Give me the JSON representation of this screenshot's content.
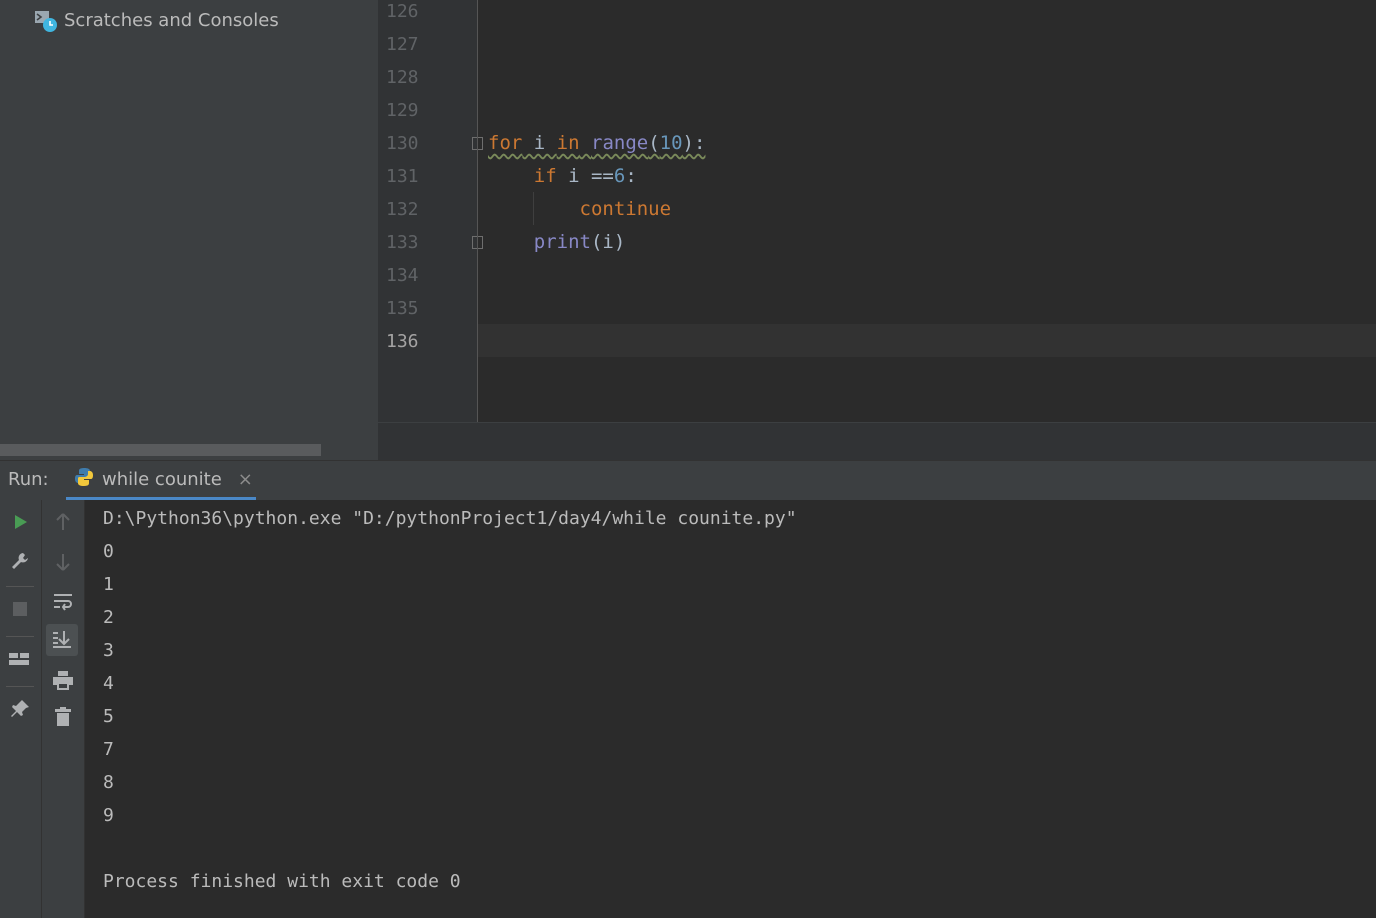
{
  "project": {
    "items": [
      {
        "label": "Scratches and Consoles",
        "icon": "scratches-icon"
      }
    ]
  },
  "editor": {
    "line_numbers": [
      "126",
      "127",
      "128",
      "129",
      "130",
      "131",
      "132",
      "133",
      "134",
      "135",
      "136"
    ],
    "current_line": "136",
    "code": [
      {
        "line": "130",
        "tokens": [
          {
            "t": "for",
            "c": "kw"
          },
          {
            "t": " i ",
            "c": "plain"
          },
          {
            "t": "in",
            "c": "kw"
          },
          {
            "t": " ",
            "c": "plain"
          },
          {
            "t": "range",
            "c": "bi"
          },
          {
            "t": "(",
            "c": "plain"
          },
          {
            "t": "10",
            "c": "num"
          },
          {
            "t": "):",
            "c": "plain"
          }
        ]
      },
      {
        "line": "131",
        "tokens": [
          {
            "t": "    ",
            "c": "plain"
          },
          {
            "t": "if",
            "c": "kw"
          },
          {
            "t": " i ==",
            "c": "plain"
          },
          {
            "t": "6",
            "c": "num"
          },
          {
            "t": ":",
            "c": "plain"
          }
        ]
      },
      {
        "line": "132",
        "tokens": [
          {
            "t": "        ",
            "c": "plain"
          },
          {
            "t": "continue",
            "c": "kw"
          }
        ]
      },
      {
        "line": "133",
        "tokens": [
          {
            "t": "    ",
            "c": "plain"
          },
          {
            "t": "print",
            "c": "bi"
          },
          {
            "t": "(i)",
            "c": "plain"
          }
        ]
      }
    ]
  },
  "run": {
    "label": "Run:",
    "tab_title": "while counite",
    "tab_close": "×",
    "output": [
      "D:\\Python36\\python.exe \"D:/pythonProject1/day4/while counite.py\"",
      "0",
      "1",
      "2",
      "3",
      "4",
      "5",
      "7",
      "8",
      "9",
      "",
      "Process finished with exit code 0"
    ]
  },
  "icons": {
    "left_toolbar": [
      "run-icon",
      "wrench-icon",
      "stop-icon",
      "layout-icon",
      "pin-icon"
    ],
    "second_toolbar": [
      "up-arrow-icon",
      "down-arrow-icon",
      "soft-wrap-icon",
      "scroll-to-end-icon",
      "print-icon",
      "trash-icon"
    ]
  },
  "colors": {
    "keyword": "#cc7832",
    "builtin": "#8888c6",
    "number": "#6897bb",
    "run_green": "#499c54",
    "tab_underline": "#4a88c7"
  }
}
